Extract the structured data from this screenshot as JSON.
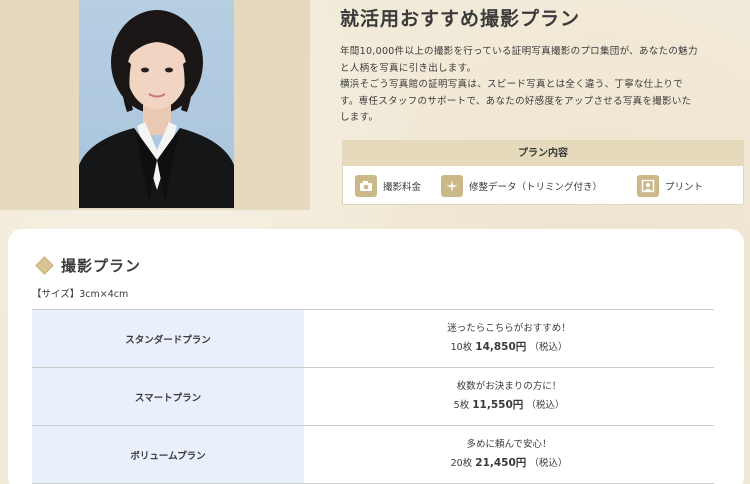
{
  "header": {
    "title": "就活用おすすめ撮影プラン",
    "description": [
      "年間10,000件以上の撮影を行っている証明写真撮影のプロ集団が、あなたの魅力",
      "と人柄を写真に引き出します。",
      "横浜そごう写真館の証明写真は、スピード写真とは全く違う、丁寧な仕上りで",
      "す。専任スタッフのサポートで、あなたの好感度をアップさせる写真を撮影いた",
      "します。"
    ]
  },
  "plan_box": {
    "heading": "プラン内容",
    "features": [
      {
        "label": "撮影料金",
        "icon": "camera-icon"
      },
      {
        "label": "修整データ（トリミング付き）",
        "icon": "sparkle-icon"
      },
      {
        "label": "プリント",
        "icon": "portrait-print-icon"
      }
    ]
  },
  "plans": {
    "title": "撮影プラン",
    "size_note": "【サイズ】3cm×4cm",
    "rows": [
      {
        "name": "スタンダードプラン",
        "tagline": "迷ったらこちらがおすすめ！",
        "count": "10枚",
        "price": "14,850円",
        "tax": "（税込）"
      },
      {
        "name": "スマートプラン",
        "tagline": "枚数がお決まりの方に！",
        "count": "5枚",
        "price": "11,550円",
        "tax": "（税込）"
      },
      {
        "name": "ボリュームプラン",
        "tagline": "多めに頼んで安心！",
        "count": "20枚",
        "price": "21,450円",
        "tax": "（税込）"
      }
    ]
  },
  "colors": {
    "background": "#f2ead8",
    "accent_tan": "#cbb98a",
    "table_name_bg": "#eaf0fb"
  }
}
